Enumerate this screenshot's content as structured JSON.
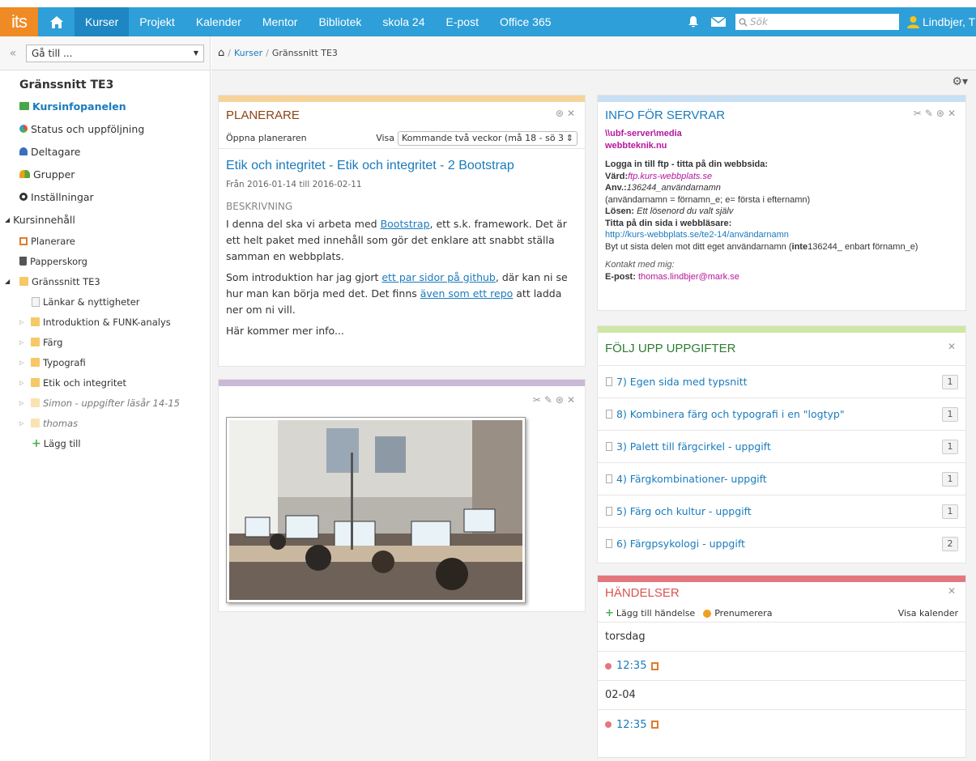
{
  "topbar": {
    "logo": "its",
    "nav": [
      "Kurser",
      "Projekt",
      "Kalender",
      "Mentor",
      "Bibliotek",
      "skola 24",
      "E-post",
      "Office 365"
    ],
    "search_placeholder": "Sök",
    "user": "Lindbjer, Thomas"
  },
  "sidebar": {
    "goto_placeholder": "Gå till ...",
    "course_title": "Gränssnitt TE3",
    "items": [
      {
        "label": "Kursinfopanelen",
        "icon": "kursinfo-icon"
      },
      {
        "label": "Status och uppföljning",
        "icon": "status-icon"
      },
      {
        "label": "Deltagare",
        "icon": "person-icon"
      },
      {
        "label": "Grupper",
        "icon": "group-icon"
      },
      {
        "label": "Inställningar",
        "icon": "gear-icon"
      }
    ],
    "content_header": "Kursinnehåll",
    "tree": [
      {
        "label": "Planerare",
        "indent": 0,
        "icon": "planner-icon",
        "arrow": false,
        "italic": false
      },
      {
        "label": "Papperskorg",
        "indent": 0,
        "icon": "trash-icon",
        "arrow": false,
        "italic": false
      },
      {
        "label": "Gränssnitt TE3",
        "indent": 0,
        "icon": "folder-icon",
        "arrow": true,
        "italic": false
      },
      {
        "label": "Länkar & nyttigheter",
        "indent": 1,
        "icon": "doc-icon",
        "arrow": false,
        "italic": false
      },
      {
        "label": "Introduktion & FUNK-analys",
        "indent": 1,
        "icon": "folder-icon",
        "arrow": true,
        "italic": false
      },
      {
        "label": "Färg",
        "indent": 1,
        "icon": "folder-icon",
        "arrow": true,
        "italic": false
      },
      {
        "label": "Typografi",
        "indent": 1,
        "icon": "folder-icon",
        "arrow": true,
        "italic": false
      },
      {
        "label": "Etik och integritet",
        "indent": 1,
        "icon": "folder-icon",
        "arrow": true,
        "italic": false
      },
      {
        "label": "Simon - uppgifter läsår 14-15",
        "indent": 1,
        "icon": "folder-icon",
        "arrow": true,
        "italic": true
      },
      {
        "label": "thomas",
        "indent": 1,
        "icon": "folder-icon",
        "arrow": true,
        "italic": true
      }
    ],
    "add_label": "Lägg till"
  },
  "breadcrumb": {
    "home": "⌂",
    "sep": "/",
    "course": "Kurser",
    "current": "Gränssnitt TE3"
  },
  "planner": {
    "title": "PLANERARE",
    "open_label": "Öppna planeraren",
    "show_label": "Visa",
    "select_value": "Kommande två veckor (må 18 - sö 3",
    "item_title": "Etik och integritet - Etik och integritet - 2 Bootstrap",
    "dates": "Från 2016-01-14 till 2016-02-11",
    "desc_header": "BESKRIVNING",
    "p1_a": "I denna del ska vi arbeta med ",
    "p1_link": "Bootstrap",
    "p1_b": ", ett s.k. framework. Det är ett helt paket med innehåll som gör det enklare att snabbt ställa samman en webbplats.",
    "p2_a": "Som introduktion har jag gjort ",
    "p2_link1": "ett par sidor på github",
    "p2_b": ", där kan ni se hur man kan börja med det. Det finns ",
    "p2_link2": "även som ett repo",
    "p2_c": " att ladda ner om ni vill.",
    "p3": "Här kommer mer info..."
  },
  "servers": {
    "title": "INFO FÖR SERVRAR",
    "l1": "\\\\ubf-server\\media",
    "l2": "webbteknik.nu",
    "l3": "Logga in till ftp - titta på din webbsida:",
    "host_label": "Värd:",
    "host": "ftp.kurs-webbplats.se",
    "user_label": "Anv.:",
    "user": "136244_användarnamn",
    "user_note": "(användarnamn = förnamn_e; e= första i efternamn)",
    "pw_label": "Lösen:",
    "pw": " Ett lösenord du valt själv",
    "view_label": "Titta på din sida i webbläsare:",
    "url": "http://kurs-webbplats.se/te2-14/användarnamn",
    "replace_a": "Byt ut sista delen mot ditt eget användarnamn (",
    "replace_b": "inte",
    "replace_c": "136244_ enbart förnamn_e)",
    "contact": "Kontakt med mig:",
    "email_label": "E-post:",
    "email": " thomas.lindbjer@mark.se"
  },
  "tasks": {
    "title": "FÖLJ UPP UPPGIFTER",
    "items": [
      {
        "label": "7) Egen sida med typsnitt",
        "count": "1"
      },
      {
        "label": "8) Kombinera färg och typografi i en \"logtyp\"",
        "count": "1"
      },
      {
        "label": "3) Palett till färgcirkel - uppgift",
        "count": "1"
      },
      {
        "label": "4) Färgkombinationer- uppgift",
        "count": "1"
      },
      {
        "label": "5) Färg och kultur - uppgift",
        "count": "1"
      },
      {
        "label": "6) Färgpsykologi - uppgift",
        "count": "2"
      }
    ]
  },
  "events": {
    "title": "HÄNDELSER",
    "add": "Lägg till händelse",
    "subscribe": "Prenumerera",
    "calendar": "Visa kalender",
    "groups": [
      {
        "day": "torsdag",
        "time": "12:35"
      },
      {
        "day": "02-04",
        "time": "12:35"
      }
    ]
  },
  "colors": {
    "topbar": "#2e9fd8",
    "accent": "#1a7bbd",
    "planner": "#f6d39a",
    "servers": "#c8dff4",
    "tasks": "#cfe7a6",
    "events": "#e4777d",
    "image": "#c9b8d6"
  }
}
